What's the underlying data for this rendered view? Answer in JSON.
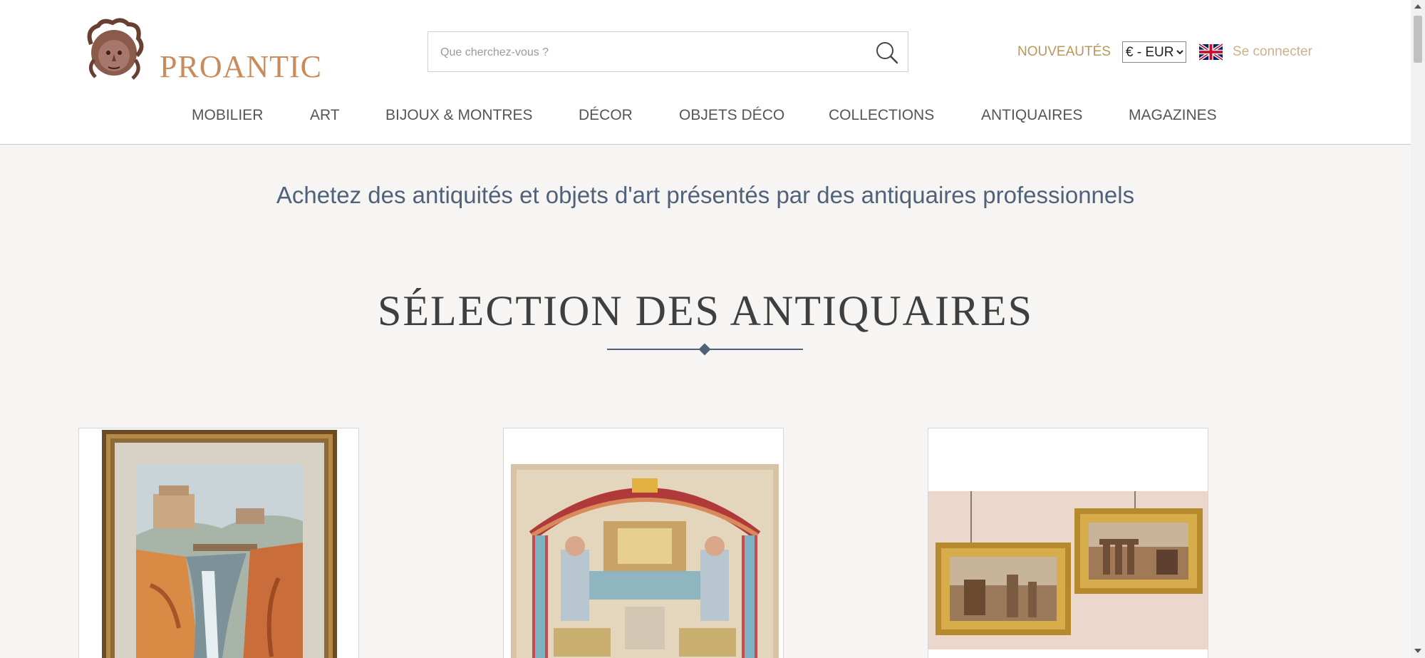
{
  "header": {
    "logo_text": "PROANTIC",
    "search_placeholder": "Que cherchez-vous ?",
    "nouveautes": "NOUVEAUTÉS",
    "currency_selected": "€ - EUR",
    "login": "Se connecter"
  },
  "nav": {
    "items": [
      "MOBILIER",
      "ART",
      "BIJOUX & MONTRES",
      "DÉCOR",
      "OBJETS DÉCO",
      "COLLECTIONS",
      "ANTIQUAIRES",
      "MAGAZINES"
    ]
  },
  "main": {
    "tagline": "Achetez des antiquités et objets d'art présentés par des antiquaires professionnels",
    "section_title": "SÉLECTION DES ANTIQUAIRES"
  },
  "cards": [
    {
      "image": "framed-waterfall-painting"
    },
    {
      "image": "judaica-embroidered-tapestry"
    },
    {
      "image": "pair-framed-ruins-paintings"
    }
  ],
  "colors": {
    "accent_gold": "#b9975b",
    "logo_copper": "#c98b5b",
    "tagline_blue": "#50627a",
    "background": "#f6f5f3"
  }
}
